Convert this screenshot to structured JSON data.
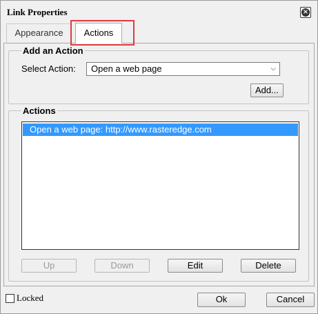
{
  "dialog": {
    "title": "Link Properties",
    "close_icon": "close-icon"
  },
  "tabs": [
    {
      "label": "Appearance",
      "selected": false
    },
    {
      "label": "Actions",
      "selected": true
    }
  ],
  "add_action": {
    "group_label": "Add an Action",
    "select_label": "Select Action:",
    "select_value": "Open a web page",
    "add_button": "Add..."
  },
  "actions": {
    "group_label": "Actions",
    "items": [
      {
        "label": "Open a web page: http://www.rasteredge.com",
        "selected": true
      }
    ],
    "buttons": {
      "up": "Up",
      "down": "Down",
      "edit": "Edit",
      "delete": "Delete"
    }
  },
  "footer": {
    "locked_label": "Locked",
    "ok": "Ok",
    "cancel": "Cancel"
  },
  "colors": {
    "highlight_box": "#e0393e",
    "selection": "#3399ff"
  }
}
